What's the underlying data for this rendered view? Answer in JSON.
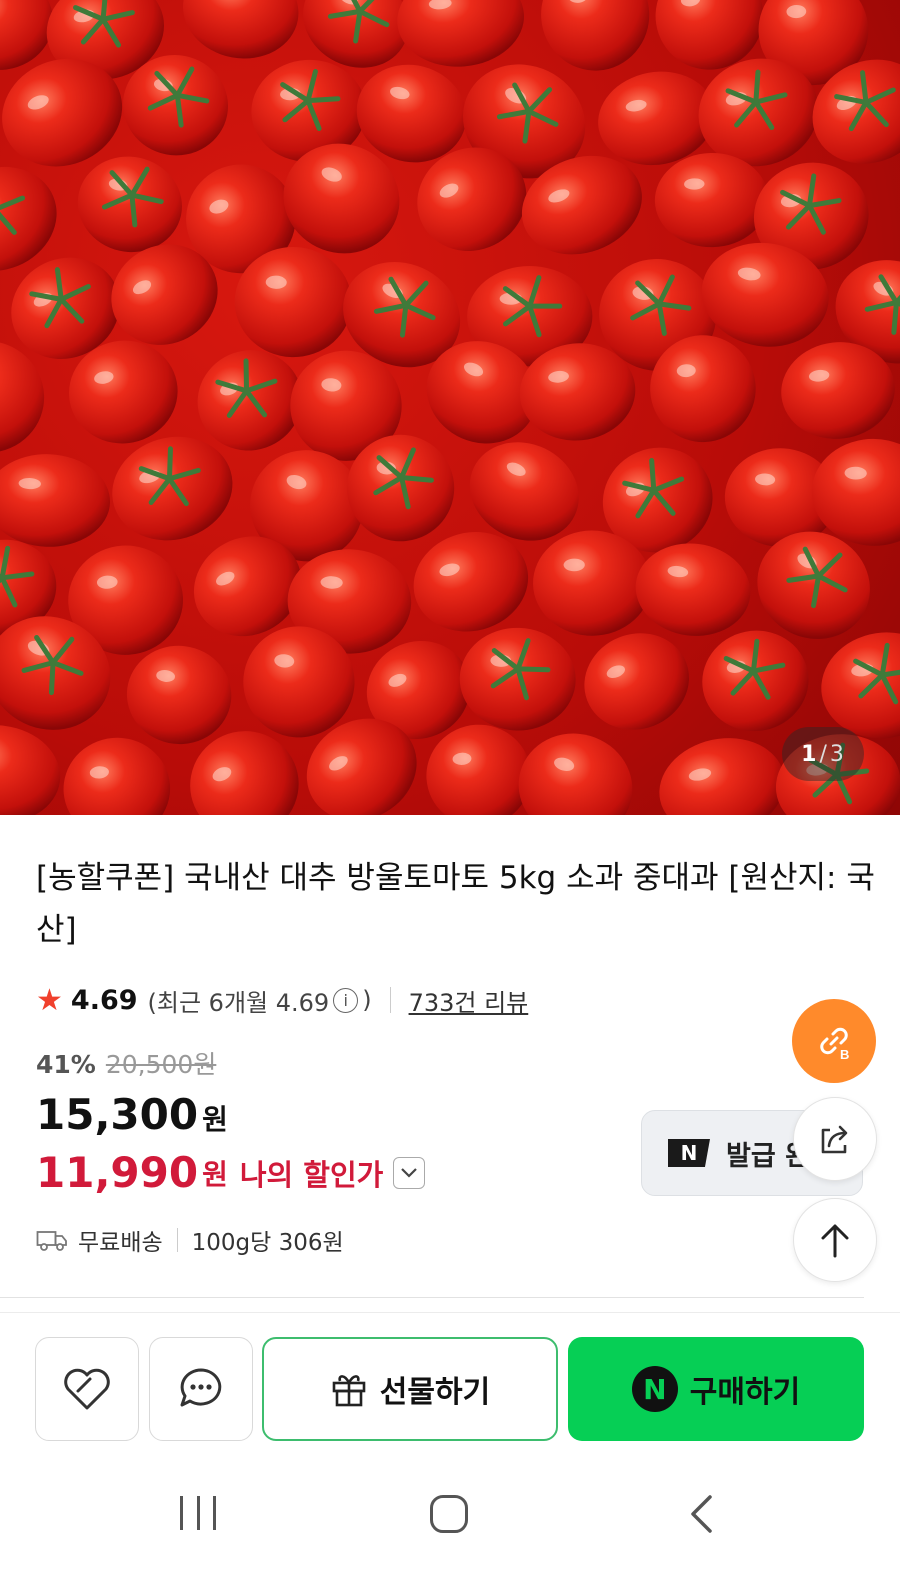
{
  "gallery": {
    "current": "1",
    "separator": "/",
    "total": "3"
  },
  "product": {
    "title": "[농할쿠폰] 국내산 대추 방울토마토 5kg 소과 중대과 [원산지: 국산]"
  },
  "rating": {
    "value": "4.69",
    "recent_prefix": "(최근 6개월 4.69",
    "recent_suffix": ")",
    "reviews": "733건 리뷰"
  },
  "price": {
    "discount_rate": "41%",
    "original": "20,500원",
    "sale": "15,300",
    "sale_unit": "원",
    "my_price": "11,990",
    "my_price_unit": "원",
    "my_price_label": "나의 할인가"
  },
  "shipping": {
    "free_label": "무료배송",
    "unit_price": "100g당 306원"
  },
  "coupon": {
    "logo": "N",
    "label": "발급 완"
  },
  "bottom_bar": {
    "gift_label": "선물하기",
    "buy_logo": "N",
    "buy_label": "구매하기"
  },
  "colors": {
    "accent_green": "#06cf55",
    "price_red": "#d11a3a",
    "link_orange": "#ff8a2b",
    "star": "#f0402c"
  },
  "icons": {
    "wish": "heart-icon",
    "chat": "chat-bubble-icon",
    "gift": "gift-icon",
    "share": "share-icon",
    "link": "link-icon",
    "top": "arrow-up-icon",
    "shipping": "truck-icon"
  }
}
